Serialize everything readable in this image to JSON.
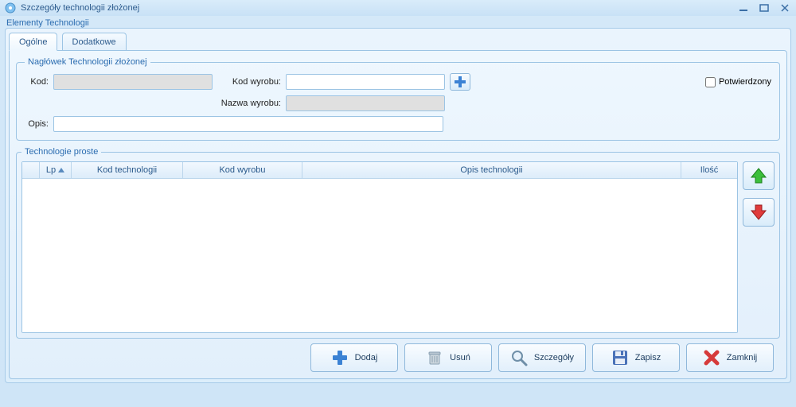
{
  "window": {
    "title": "Szczegóły technologii złożonej"
  },
  "section": {
    "label": "Elementy Technologii"
  },
  "tabs": {
    "general": "Ogólne",
    "additional": "Dodatkowe"
  },
  "group_header": {
    "legend": "Nagłówek Technologii złożonej",
    "kod_label": "Kod:",
    "kod_value": "",
    "kod_wyrobu_label": "Kod wyrobu:",
    "kod_wyrobu_value": "",
    "nazwa_wyrobu_label": "Nazwa wyrobu:",
    "nazwa_wyrobu_value": "",
    "opis_label": "Opis:",
    "opis_value": "",
    "confirmed_label": "Potwierdzony"
  },
  "group_simple": {
    "legend": "Technologie proste",
    "columns": {
      "lp": "Lp",
      "kod_tech": "Kod technologii",
      "kod_wyrobu": "Kod wyrobu",
      "opis_tech": "Opis technologii",
      "ilosc": "Ilość"
    }
  },
  "buttons": {
    "add": "Dodaj",
    "delete": "Usuń",
    "details": "Szczegóły",
    "save": "Zapisz",
    "close": "Zamknij"
  }
}
